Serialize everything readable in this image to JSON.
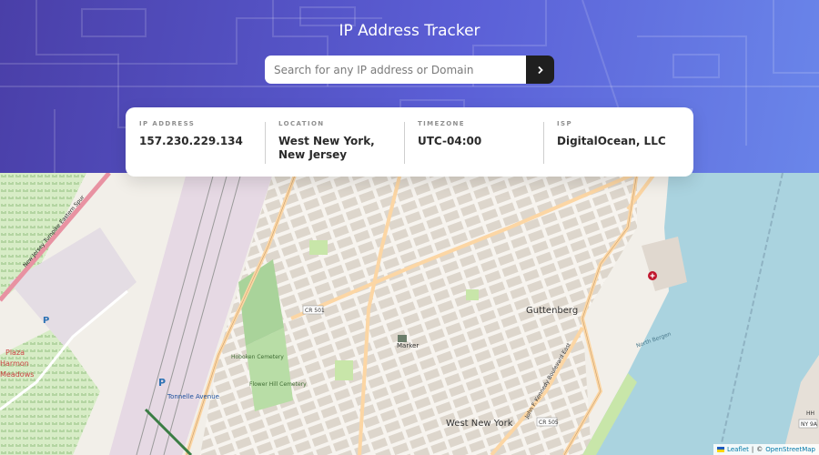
{
  "header": {
    "title": "IP Address Tracker",
    "gradient_start": "#4a3fa8",
    "gradient_end": "#6a86ea"
  },
  "search": {
    "placeholder": "Search for any IP address or Domain",
    "value": "",
    "submit_icon": "chevron-right-icon",
    "button_color": "#1f1f1f"
  },
  "info": [
    {
      "label": "IP ADDRESS",
      "value": "157.230.229.134"
    },
    {
      "label": "LOCATION",
      "value": "West New York, New Jersey"
    },
    {
      "label": "TIMEZONE",
      "value": "UTC-04:00"
    },
    {
      "label": "ISP",
      "value": "DigitalOcean, LLC"
    }
  ],
  "map": {
    "marker_label": "Marker",
    "labels": {
      "west_new_york": "West New York",
      "guttenberg": "Guttenberg",
      "hoboken_cemetery": "Hoboken Cemetery",
      "flower_hill_cemetery": "Flower Hill Cemetery",
      "tonnelle_avenue": "Tonnelle Avenue",
      "cr_501": "CR 501",
      "cr_505": "CR 505",
      "plaza": "Plaza",
      "harmon": "Harmon",
      "meadows": "Meadows",
      "new_jersey_turnpike": "New Jersey Turnpike Eastern Spur",
      "jfk_boulevard": "John F. Kennedy Boulevard East",
      "north_bergen": "North Bergen",
      "parking": "P",
      "ny_badge": "NY 9A",
      "hh": "HH"
    },
    "colors": {
      "land": "#f2efe9",
      "block": "#e0dbd3",
      "water": "#aad3df",
      "park": "#c8e6a9",
      "cemetery": "#a9d39a",
      "rail": "#e1d3df",
      "major_road": "#fcd6a4",
      "highway": "#e892a2"
    }
  },
  "attribution": {
    "leaflet": "Leaflet",
    "separator": "|",
    "copyright": "©",
    "osm": "OpenStreetMap"
  }
}
